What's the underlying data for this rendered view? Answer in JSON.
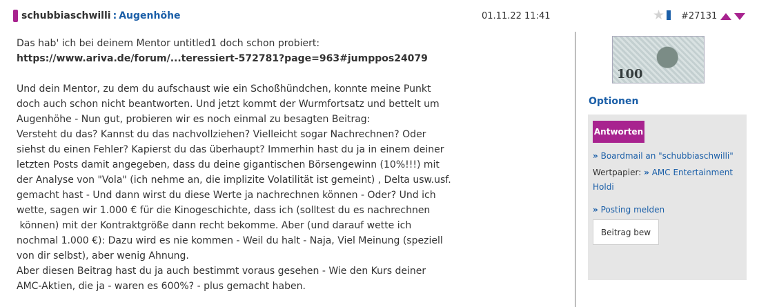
{
  "header": {
    "username": "schubbiaschwilli",
    "separator": ":",
    "thread_title": "Augenhöhe",
    "date": "01.11.22 11:41",
    "post_number": "#27131"
  },
  "colors": {
    "accent": "#a8238f",
    "link": "#1b5fa8",
    "panel": "#e6e6e6"
  },
  "post": {
    "line1": "Das hab' ich bei deinem Mentor untitled1 doch schon probiert:",
    "link": "https://www.ariva.de/forum/...teressiert-572781?page=963#jumppos24079",
    "paragraph_lines": [
      "Und dein Mentor, zu dem du aufschaust wie ein Schoßhündchen, konnte meine Punkt",
      "doch auch schon nicht beantworten. Und jetzt kommt der Wurmfortsatz und bettelt um",
      "Augenhöhe - Nun gut, probieren wir es noch einmal zu besagten Beitrag:",
      "Versteht du das? Kannst du das nachvollziehen? Vielleicht sogar Nachrechnen? Oder",
      "siehst du einen Fehler? Kapierst du das überhaupt? Immerhin hast du ja in einem deiner",
      "letzten Posts damit angegeben, dass du deine gigantischen Börsengewinn (10%!!!) mit",
      "der Analyse von \"Vola\" (ich nehme an, die implizite Volatilität ist gemeint) , Delta usw.usf.",
      "gemacht hast - Und dann wirst du diese Werte ja nachrechnen können - Oder? Und ich",
      "wette, sagen wir 1.000 € für die Kinogeschichte, dass ich (solltest du es nachrechnen",
      " können) mit der Kontraktgröße dann recht bekomme. Aber (und darauf wette ich",
      "nochmal 1.000 €): Dazu wird es nie kommen - Weil du halt - Naja, Viel Meinung (speziell",
      "von dir selbst), aber wenig Ahnung.",
      "Aber diesen Beitrag hast du ja auch bestimmt voraus gesehen - Wie den Kurs deiner",
      "AMC-Aktien, die ja - waren es 600%? - plus gemacht haben."
    ]
  },
  "sidebar": {
    "avatar_text": "100",
    "options_title": "Optionen",
    "reply_label": "Antworten",
    "boardmail_label": "Boardmail an \"schubbiaschwilli\"",
    "wertpapier_label": "Wertpapier:",
    "wertpapier_link_line1": "AMC Entertainment",
    "wertpapier_link_line2": "Holdi",
    "report_label": "Posting melden",
    "rate_label": "Beitrag bew",
    "arrow": "»"
  }
}
